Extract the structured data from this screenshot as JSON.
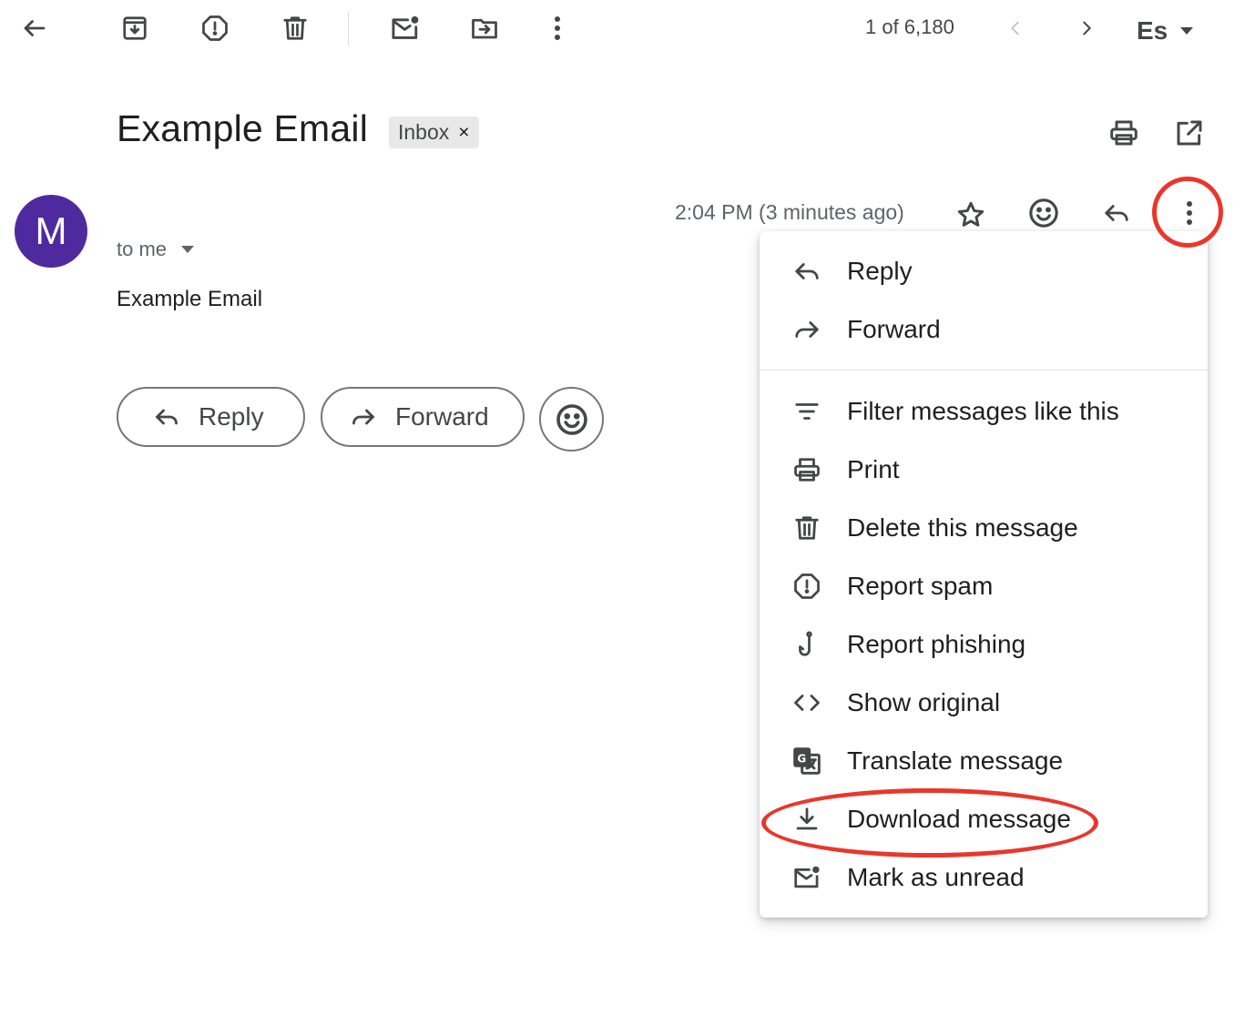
{
  "toolbar": {
    "back_icon": "arrow-back-icon",
    "archive_icon": "archive-icon",
    "spam_icon": "report-spam-icon",
    "delete_icon": "trash-icon",
    "unread_icon": "mark-unread-icon",
    "move_icon": "move-to-folder-icon",
    "more_icon": "more-vert-icon",
    "pagination": "1 of 6,180",
    "input_tool": "Es"
  },
  "thread": {
    "subject": "Example Email",
    "label_chip": "Inbox",
    "label_remove": "×"
  },
  "message": {
    "sender_initial": "M",
    "avatar_color": "#4e2a9e",
    "timestamp": "2:04 PM (3 minutes ago)",
    "recipient": "to me",
    "body": "Example Email"
  },
  "actions": {
    "reply_label": "Reply",
    "forward_label": "Forward"
  },
  "menu": {
    "items": [
      {
        "label": "Reply",
        "icon": "reply-icon"
      },
      {
        "label": "Forward",
        "icon": "forward-icon"
      },
      {
        "label": "Filter messages like this",
        "icon": "filter-icon"
      },
      {
        "label": "Print",
        "icon": "print-icon"
      },
      {
        "label": "Delete this message",
        "icon": "trash-icon"
      },
      {
        "label": "Report spam",
        "icon": "report-spam-icon"
      },
      {
        "label": "Report phishing",
        "icon": "phishing-hook-icon"
      },
      {
        "label": "Show original",
        "icon": "code-icon"
      },
      {
        "label": "Translate message",
        "icon": "translate-icon"
      },
      {
        "label": "Download message",
        "icon": "download-icon"
      },
      {
        "label": "Mark as unread",
        "icon": "mark-unread-icon"
      }
    ]
  },
  "annotations": {
    "highlight_color": "#e8372b"
  }
}
